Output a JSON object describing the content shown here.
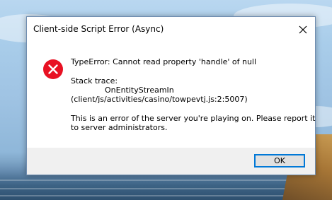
{
  "dialog": {
    "title": "Client-side Script Error (Async)",
    "message_lines": [
      "TypeError: Cannot read property 'handle' of null",
      "Stack trace:",
      "OnEntityStreamIn",
      "(client/js/activities/casino/towpevtj.js:2:5007)",
      "This is an error of the server you're playing on. Please report it",
      "to server administrators."
    ],
    "ok_label": "OK",
    "close_icon": "close-icon",
    "error_icon": "error-icon",
    "colors": {
      "error_red": "#e81123",
      "accent": "#0078d7",
      "footer": "#f0f0f0"
    }
  }
}
